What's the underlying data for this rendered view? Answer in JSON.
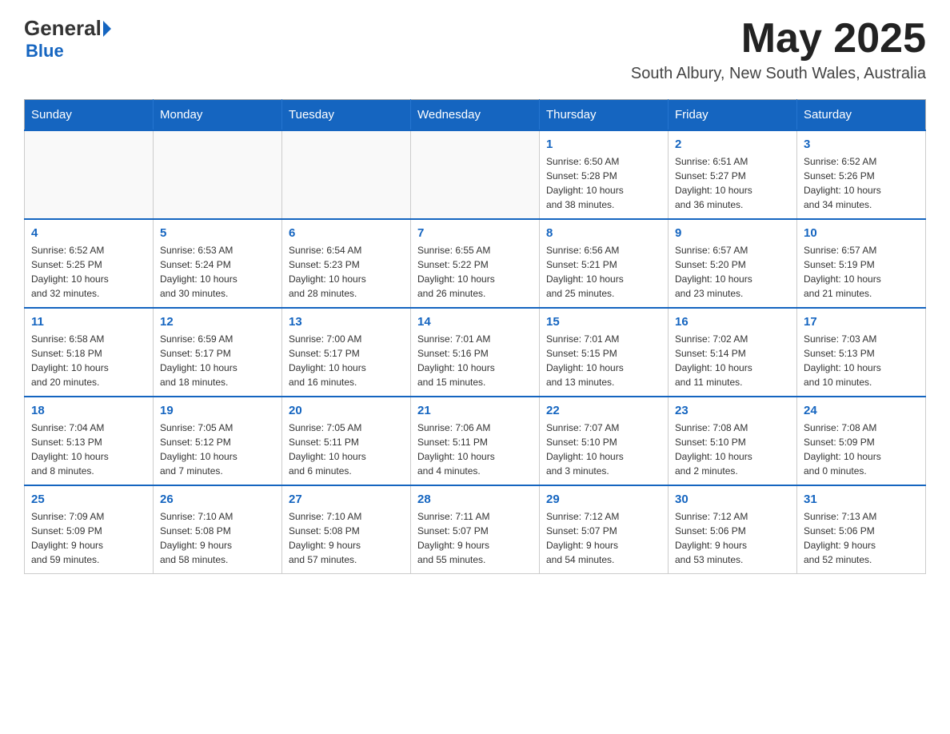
{
  "header": {
    "logo_general": "General",
    "logo_blue": "Blue",
    "month_title": "May 2025",
    "location": "South Albury, New South Wales, Australia"
  },
  "days_of_week": [
    "Sunday",
    "Monday",
    "Tuesday",
    "Wednesday",
    "Thursday",
    "Friday",
    "Saturday"
  ],
  "weeks": [
    {
      "days": [
        {
          "number": "",
          "info": ""
        },
        {
          "number": "",
          "info": ""
        },
        {
          "number": "",
          "info": ""
        },
        {
          "number": "",
          "info": ""
        },
        {
          "number": "1",
          "info": "Sunrise: 6:50 AM\nSunset: 5:28 PM\nDaylight: 10 hours\nand 38 minutes."
        },
        {
          "number": "2",
          "info": "Sunrise: 6:51 AM\nSunset: 5:27 PM\nDaylight: 10 hours\nand 36 minutes."
        },
        {
          "number": "3",
          "info": "Sunrise: 6:52 AM\nSunset: 5:26 PM\nDaylight: 10 hours\nand 34 minutes."
        }
      ]
    },
    {
      "days": [
        {
          "number": "4",
          "info": "Sunrise: 6:52 AM\nSunset: 5:25 PM\nDaylight: 10 hours\nand 32 minutes."
        },
        {
          "number": "5",
          "info": "Sunrise: 6:53 AM\nSunset: 5:24 PM\nDaylight: 10 hours\nand 30 minutes."
        },
        {
          "number": "6",
          "info": "Sunrise: 6:54 AM\nSunset: 5:23 PM\nDaylight: 10 hours\nand 28 minutes."
        },
        {
          "number": "7",
          "info": "Sunrise: 6:55 AM\nSunset: 5:22 PM\nDaylight: 10 hours\nand 26 minutes."
        },
        {
          "number": "8",
          "info": "Sunrise: 6:56 AM\nSunset: 5:21 PM\nDaylight: 10 hours\nand 25 minutes."
        },
        {
          "number": "9",
          "info": "Sunrise: 6:57 AM\nSunset: 5:20 PM\nDaylight: 10 hours\nand 23 minutes."
        },
        {
          "number": "10",
          "info": "Sunrise: 6:57 AM\nSunset: 5:19 PM\nDaylight: 10 hours\nand 21 minutes."
        }
      ]
    },
    {
      "days": [
        {
          "number": "11",
          "info": "Sunrise: 6:58 AM\nSunset: 5:18 PM\nDaylight: 10 hours\nand 20 minutes."
        },
        {
          "number": "12",
          "info": "Sunrise: 6:59 AM\nSunset: 5:17 PM\nDaylight: 10 hours\nand 18 minutes."
        },
        {
          "number": "13",
          "info": "Sunrise: 7:00 AM\nSunset: 5:17 PM\nDaylight: 10 hours\nand 16 minutes."
        },
        {
          "number": "14",
          "info": "Sunrise: 7:01 AM\nSunset: 5:16 PM\nDaylight: 10 hours\nand 15 minutes."
        },
        {
          "number": "15",
          "info": "Sunrise: 7:01 AM\nSunset: 5:15 PM\nDaylight: 10 hours\nand 13 minutes."
        },
        {
          "number": "16",
          "info": "Sunrise: 7:02 AM\nSunset: 5:14 PM\nDaylight: 10 hours\nand 11 minutes."
        },
        {
          "number": "17",
          "info": "Sunrise: 7:03 AM\nSunset: 5:13 PM\nDaylight: 10 hours\nand 10 minutes."
        }
      ]
    },
    {
      "days": [
        {
          "number": "18",
          "info": "Sunrise: 7:04 AM\nSunset: 5:13 PM\nDaylight: 10 hours\nand 8 minutes."
        },
        {
          "number": "19",
          "info": "Sunrise: 7:05 AM\nSunset: 5:12 PM\nDaylight: 10 hours\nand 7 minutes."
        },
        {
          "number": "20",
          "info": "Sunrise: 7:05 AM\nSunset: 5:11 PM\nDaylight: 10 hours\nand 6 minutes."
        },
        {
          "number": "21",
          "info": "Sunrise: 7:06 AM\nSunset: 5:11 PM\nDaylight: 10 hours\nand 4 minutes."
        },
        {
          "number": "22",
          "info": "Sunrise: 7:07 AM\nSunset: 5:10 PM\nDaylight: 10 hours\nand 3 minutes."
        },
        {
          "number": "23",
          "info": "Sunrise: 7:08 AM\nSunset: 5:10 PM\nDaylight: 10 hours\nand 2 minutes."
        },
        {
          "number": "24",
          "info": "Sunrise: 7:08 AM\nSunset: 5:09 PM\nDaylight: 10 hours\nand 0 minutes."
        }
      ]
    },
    {
      "days": [
        {
          "number": "25",
          "info": "Sunrise: 7:09 AM\nSunset: 5:09 PM\nDaylight: 9 hours\nand 59 minutes."
        },
        {
          "number": "26",
          "info": "Sunrise: 7:10 AM\nSunset: 5:08 PM\nDaylight: 9 hours\nand 58 minutes."
        },
        {
          "number": "27",
          "info": "Sunrise: 7:10 AM\nSunset: 5:08 PM\nDaylight: 9 hours\nand 57 minutes."
        },
        {
          "number": "28",
          "info": "Sunrise: 7:11 AM\nSunset: 5:07 PM\nDaylight: 9 hours\nand 55 minutes."
        },
        {
          "number": "29",
          "info": "Sunrise: 7:12 AM\nSunset: 5:07 PM\nDaylight: 9 hours\nand 54 minutes."
        },
        {
          "number": "30",
          "info": "Sunrise: 7:12 AM\nSunset: 5:06 PM\nDaylight: 9 hours\nand 53 minutes."
        },
        {
          "number": "31",
          "info": "Sunrise: 7:13 AM\nSunset: 5:06 PM\nDaylight: 9 hours\nand 52 minutes."
        }
      ]
    }
  ]
}
